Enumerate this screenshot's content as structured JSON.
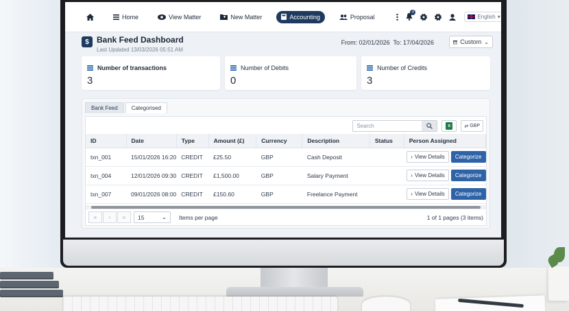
{
  "navbar": {
    "items": [
      {
        "label": "Home",
        "icon": "home-icon"
      },
      {
        "label": "View Matter",
        "icon": "eye-icon"
      },
      {
        "label": "New Matter",
        "icon": "folder-plus-icon"
      },
      {
        "label": "Accounting",
        "icon": "calculator-icon",
        "active": true
      },
      {
        "label": "Proposal",
        "icon": "users-icon"
      }
    ],
    "notification_count": "0",
    "language": "English"
  },
  "header": {
    "title": "Bank Feed Dashboard",
    "last_updated": "Last Updated 13/03/2026 05:51 AM",
    "date_range": "From: 02/01/2026  To: 17/04/2026",
    "range_option": "Custom"
  },
  "stats": [
    {
      "label": "Number of transactions",
      "value": "3"
    },
    {
      "label": "Number of Debits",
      "value": "0"
    },
    {
      "label": "Number of Credits",
      "value": "3"
    }
  ],
  "tabs": [
    "Bank Feed",
    "Categorised"
  ],
  "toolbar": {
    "search_placeholder": "Search",
    "currency_button": "GBP"
  },
  "table": {
    "columns": [
      "ID",
      "Date",
      "Type",
      "Amount (£)",
      "Currency",
      "Description",
      "Status",
      "Person Assigned"
    ],
    "rows": [
      {
        "id": "txn_001",
        "date": "15/01/2026 16:20",
        "type": "CREDIT",
        "amount": "£25.50",
        "currency": "GBP",
        "description": "Cash Deposit",
        "status": ""
      },
      {
        "id": "txn_004",
        "date": "12/01/2026 09:30",
        "type": "CREDIT",
        "amount": "£1,500.00",
        "currency": "GBP",
        "description": "Salary Payment",
        "status": ""
      },
      {
        "id": "txn_007",
        "date": "09/01/2026 08:00",
        "type": "CREDIT",
        "amount": "£150.60",
        "currency": "GBP",
        "description": "Freelance Payment",
        "status": ""
      }
    ],
    "view_details_label": "View Details",
    "categorize_label": "Categorize"
  },
  "pager": {
    "page_size": "15",
    "items_per_page_label": "Items per page",
    "info": "1 of 1 pages (3 items)"
  },
  "colors": {
    "primary": "#1f3a5f",
    "accent": "#2e63a8"
  }
}
